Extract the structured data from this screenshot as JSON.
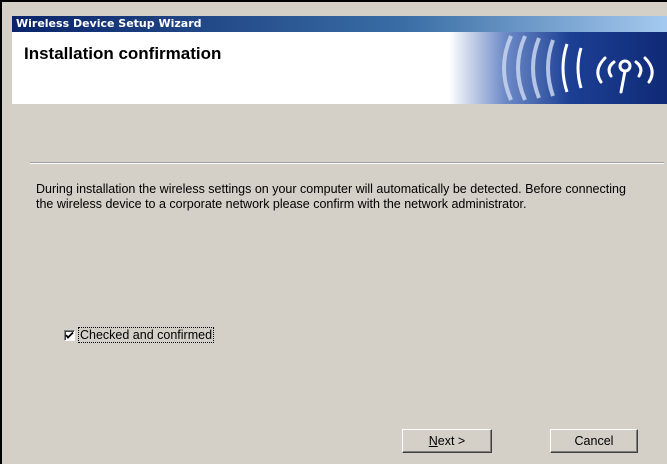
{
  "window": {
    "title": "Wireless Device Setup Wizard"
  },
  "header": {
    "title": "Installation confirmation",
    "art_icon": "wireless-signal-icon"
  },
  "body": {
    "description": "During installation the wireless settings on your computer will automatically be detected. Before connecting the wireless device to a corporate network please confirm with the network administrator."
  },
  "confirm_checkbox": {
    "label": "Checked and confirmed",
    "checked": true
  },
  "buttons": {
    "next_mnemonic": "N",
    "next_rest": "ext >",
    "cancel_label": "Cancel"
  },
  "colors": {
    "titlebar": "#0a246a",
    "dialog_bg": "#d4d0c8",
    "header_art": "#1c3f94"
  }
}
